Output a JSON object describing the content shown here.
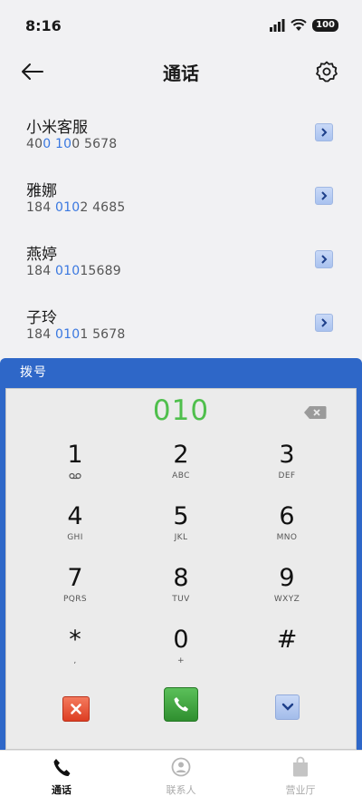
{
  "status": {
    "time": "8:16",
    "battery": "100"
  },
  "header": {
    "title": "通话"
  },
  "contacts": [
    {
      "name": "小米客服",
      "number_parts": [
        "40",
        "0 10",
        "0 5678"
      ]
    },
    {
      "name": "雅娜",
      "number_parts": [
        "184 ",
        "010",
        "2 4685"
      ]
    },
    {
      "name": "燕婷",
      "number_parts": [
        "184 ",
        "010",
        "15689"
      ]
    },
    {
      "name": "子玲",
      "number_parts": [
        "184 ",
        "010",
        "1 5678"
      ]
    }
  ],
  "dialer": {
    "title": "拨号",
    "input_value": "010",
    "keys": [
      {
        "digit": "1",
        "letters": ""
      },
      {
        "digit": "2",
        "letters": "ABC"
      },
      {
        "digit": "3",
        "letters": "DEF"
      },
      {
        "digit": "4",
        "letters": "GHI"
      },
      {
        "digit": "5",
        "letters": "JKL"
      },
      {
        "digit": "6",
        "letters": "MNO"
      },
      {
        "digit": "7",
        "letters": "PQRS"
      },
      {
        "digit": "8",
        "letters": "TUV"
      },
      {
        "digit": "9",
        "letters": "WXYZ"
      },
      {
        "digit": "*",
        "letters": ","
      },
      {
        "digit": "0",
        "letters": "+"
      },
      {
        "digit": "#",
        "letters": ""
      }
    ]
  },
  "bottom_nav": [
    {
      "label": "通话",
      "icon": "phone-icon",
      "active": true
    },
    {
      "label": "联系人",
      "icon": "contact-icon",
      "active": false
    },
    {
      "label": "营业厅",
      "icon": "bag-icon",
      "active": false
    }
  ],
  "colors": {
    "accent_blue": "#2e67c8",
    "highlight_blue": "#3a78e0",
    "input_green": "#4fbf4c"
  }
}
